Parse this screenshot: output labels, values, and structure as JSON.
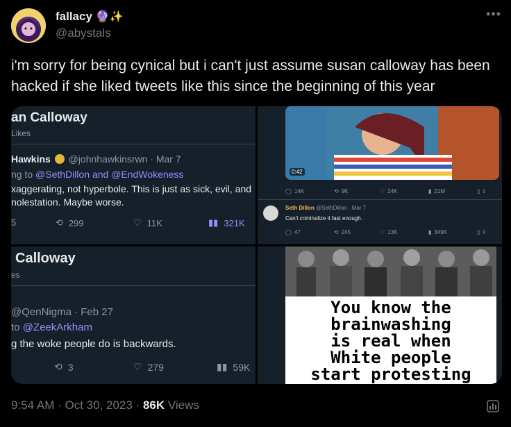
{
  "author": {
    "name": "fallacy",
    "emoji": "🔮✨",
    "handle": "@abystals"
  },
  "tweet_text": "i'm sorry for being cynical but i can't just assume susan calloway has been hacked if she liked tweets like this since the beginning of this year",
  "media": {
    "q1": {
      "header_title": "an Calloway",
      "header_sub": "Likes",
      "author_name": "Hawkins",
      "author_handle": "@johnhawkinsrwn · Mar 7",
      "reply_prefix": "ng to",
      "reply_target1": "@SethDillon",
      "reply_and": "and",
      "reply_target2": "@EndWokeness",
      "body_line1": "xaggerating, not hyperbole. This is just as sick, evil, and",
      "body_line2": "nolestation. Maybe worse.",
      "stat_reply": "5",
      "stat_retweet": "299",
      "stat_like": "11K",
      "stat_views": "321K"
    },
    "q2": {
      "video_time": "0:42",
      "top_stats": [
        "14K",
        "9K",
        "24K",
        "21M"
      ],
      "author_name": "Seth Dillon",
      "author_handle": "@SethDillon · Mar 7",
      "body": "Can't criminalize it fast enough.",
      "stats": [
        "47",
        "245",
        "13K",
        "349K"
      ]
    },
    "q3": {
      "header_title": "Calloway",
      "header_sub": "es",
      "author_handle": "@QenNigma · Feb 27",
      "reply_prefix": "to",
      "reply_target": "@ZeekArkham",
      "body": "g the woke people do is backwards.",
      "stat_retweet": "3",
      "stat_like": "279",
      "stat_views": "59K"
    },
    "q4": {
      "meme_line1": "You know the",
      "meme_line2": "brainwashing",
      "meme_line3": "is real when",
      "meme_line4": "White people",
      "meme_line5": "start protesting"
    }
  },
  "footer": {
    "time": "9:54 AM",
    "date": "Oct 30, 2023",
    "views_count": "86K",
    "views_label": "Views"
  },
  "colors": {
    "accent": "#1d9bf0",
    "link_purple": "#9b8cff",
    "background": "#000000",
    "card_bg": "#15202b"
  },
  "icons": [
    "more-icon",
    "reply-icon",
    "retweet-icon",
    "like-icon",
    "views-icon",
    "bookmark-icon",
    "share-icon",
    "analytics-icon",
    "verified-badge-icon"
  ]
}
